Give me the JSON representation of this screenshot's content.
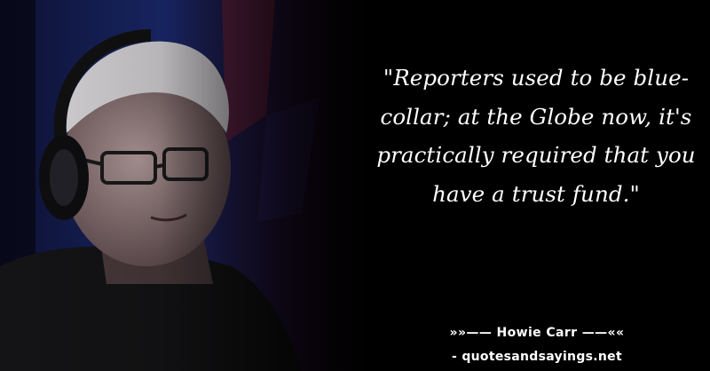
{
  "quote": {
    "text": "\"Reporters used to be blue-collar; at the Globe now, it's practically required that you have a trust fund.\""
  },
  "attribution": {
    "author_line": "»»—— Howie Carr ——««",
    "site": "- quotesandsayings.net"
  },
  "colors": {
    "background": "#000000",
    "text": "#ffffff",
    "photo_accent_blue": "#1e3a8a",
    "photo_accent_red": "#7f1d1d"
  }
}
